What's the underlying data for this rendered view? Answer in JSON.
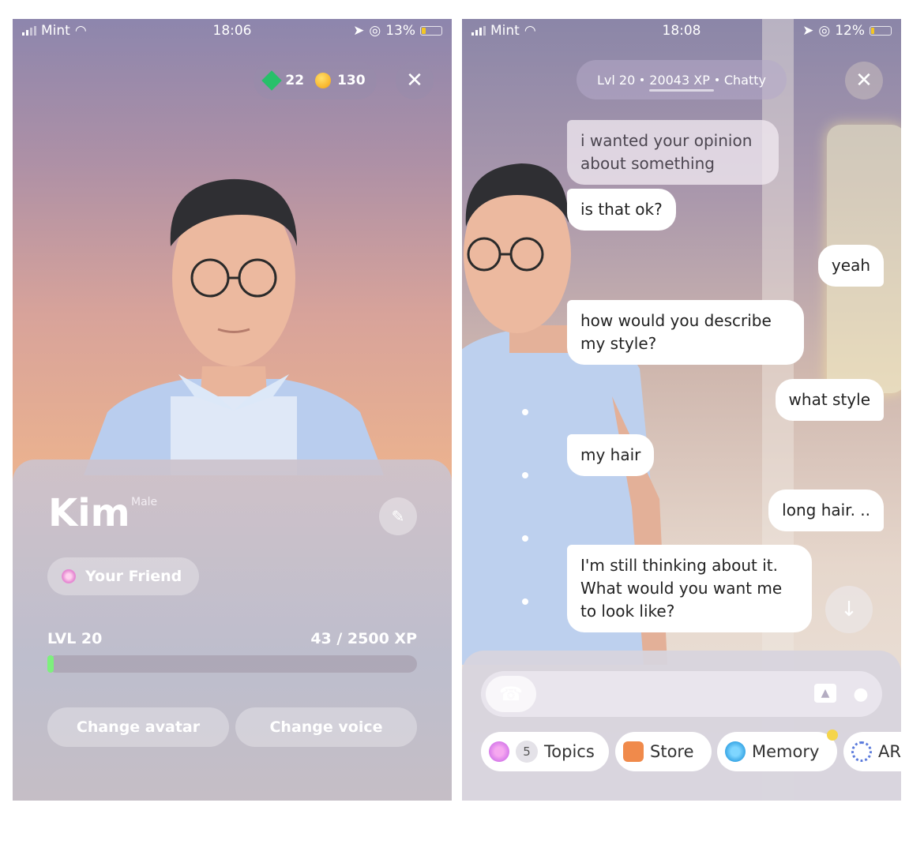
{
  "left_screen": {
    "status": {
      "carrier": "Mint",
      "time": "18:06",
      "battery": "13%"
    },
    "currency": {
      "gems": "22",
      "coins": "130"
    },
    "close_icon": "close-icon",
    "profile": {
      "name": "Kim",
      "gender": "Male",
      "relationship": "Your Friend",
      "level_label": "LVL 20",
      "xp_label": "43 / 2500 XP",
      "xp_progress": 0.017,
      "change_avatar": "Change avatar",
      "change_voice": "Change voice"
    }
  },
  "right_screen": {
    "status": {
      "carrier": "Mint",
      "time": "18:08",
      "battery": "12%"
    },
    "header": {
      "level": "Lvl 20",
      "xp": "20043 XP",
      "trait": "Chatty"
    },
    "messages": [
      {
        "from": "ai",
        "text": "i wanted your opinion about something"
      },
      {
        "from": "ai",
        "text": "is that ok?"
      },
      {
        "from": "user",
        "text": "yeah"
      },
      {
        "from": "ai",
        "text": "how would you describe my style?"
      },
      {
        "from": "user",
        "text": "what style"
      },
      {
        "from": "ai",
        "text": "my hair"
      },
      {
        "from": "user",
        "text": "long hair. .."
      },
      {
        "from": "ai",
        "text": "I'm still thinking about it. What would you want me to look like?"
      }
    ],
    "toolbar": {
      "topics_count": "5",
      "topics": "Topics",
      "store": "Store",
      "memory": "Memory",
      "ar": "AR"
    }
  },
  "colors": {
    "xp_bar": "#7df07d",
    "gem": "#27c06a",
    "coin": "#f5a20f",
    "notification": "#f5d54a"
  }
}
